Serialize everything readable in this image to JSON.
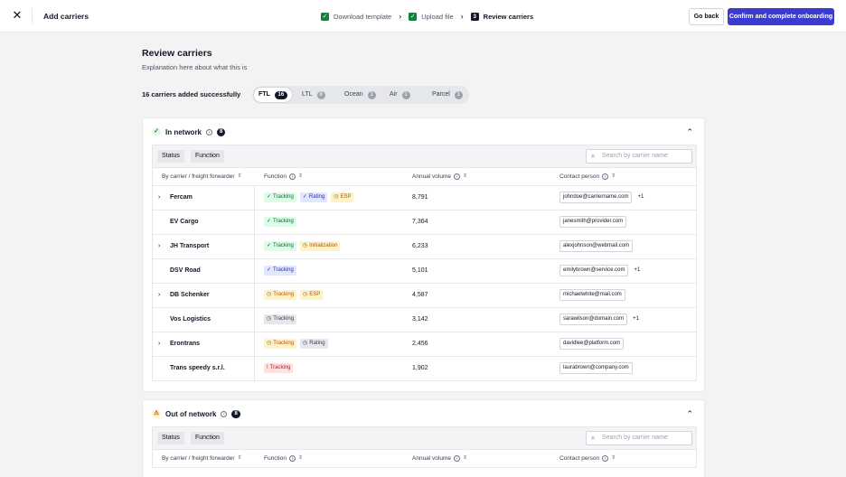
{
  "header": {
    "close_icon": "close-icon",
    "title": "Add carriers",
    "steps": [
      {
        "label": "Download template",
        "state": "done"
      },
      {
        "label": "Upload file",
        "state": "done"
      },
      {
        "label": "Review carriers",
        "number": "3",
        "state": "current"
      }
    ],
    "go_back": "Go back",
    "confirm": "Confirm and complete onboarding"
  },
  "page": {
    "title": "Review carriers",
    "subtitle": "Explanation here about what this is",
    "added_text": "16 carriers added successfully"
  },
  "modes": [
    {
      "label": "FTL",
      "count": "16",
      "active": true
    },
    {
      "label": "LTL",
      "count": "8"
    },
    {
      "label": "Ocean",
      "count": "1"
    },
    {
      "label": "Air",
      "count": "1"
    },
    {
      "label": "Parcel",
      "count": "1"
    }
  ],
  "in_network": {
    "title": "In network",
    "count": "8",
    "filters": [
      "Status",
      "Function"
    ],
    "search_placeholder": "Search by carrier name",
    "columns": [
      "By carrier / freight forwarder",
      "Function",
      "Annual volume",
      "Contact person"
    ],
    "rows": [
      {
        "expand": true,
        "name": "Fercam",
        "tags": [
          {
            "t": "Tracking",
            "c": "green",
            "i": "ok"
          },
          {
            "t": "Rating",
            "c": "blue",
            "i": "ok"
          },
          {
            "t": "ESP",
            "c": "amber",
            "i": "pending"
          }
        ],
        "volume": "8,791",
        "email": "johndoe@carriername.com",
        "more": "+1"
      },
      {
        "expand": false,
        "name": "EV Cargo",
        "tags": [
          {
            "t": "Tracking",
            "c": "green",
            "i": "ok"
          }
        ],
        "volume": "7,364",
        "email": "janesmith@provider.com",
        "more": ""
      },
      {
        "expand": true,
        "name": "JH Transport",
        "tags": [
          {
            "t": "Tracking",
            "c": "green",
            "i": "ok"
          },
          {
            "t": "Initialization",
            "c": "amber",
            "i": "pending"
          }
        ],
        "volume": "6,233",
        "email": "alexjohnson@webmail.com",
        "more": ""
      },
      {
        "expand": false,
        "name": "DSV Road",
        "tags": [
          {
            "t": "Tracking",
            "c": "blue",
            "i": "ok"
          }
        ],
        "volume": "5,101",
        "email": "emilybrown@service.com",
        "more": "+1"
      },
      {
        "expand": true,
        "name": "DB Schenker",
        "tags": [
          {
            "t": "Tracking",
            "c": "amber",
            "i": "pending"
          },
          {
            "t": "ESP",
            "c": "amber",
            "i": "pending"
          }
        ],
        "volume": "4,587",
        "email": "michaelwhite@mail.com",
        "more": ""
      },
      {
        "expand": false,
        "name": "Vos Logistics",
        "tags": [
          {
            "t": "Tracking",
            "c": "gray",
            "i": "pending"
          }
        ],
        "volume": "3,142",
        "email": "sarawilson@domain.com",
        "more": "+1"
      },
      {
        "expand": true,
        "name": "Erontrans",
        "tags": [
          {
            "t": "Tracking",
            "c": "amber",
            "i": "pending"
          },
          {
            "t": "Rating",
            "c": "gray",
            "i": "pending"
          }
        ],
        "volume": "2,456",
        "email": "davidlee@platform.com",
        "more": ""
      },
      {
        "expand": false,
        "name": "Trans speedy s.r.l.",
        "tags": [
          {
            "t": "Tracking",
            "c": "red",
            "i": "error"
          }
        ],
        "volume": "1,902",
        "email": "laurabrown@company.com",
        "more": ""
      }
    ]
  },
  "out_network": {
    "title": "Out of network",
    "count": "8",
    "filters": [
      "Status",
      "Function"
    ],
    "search_placeholder": "Search by carrier name",
    "columns": [
      "By carrier / freight forwarder",
      "Function",
      "Annual volume",
      "Contact person"
    ]
  },
  "colors": {
    "accent": "#3b3bd0",
    "success": "#15803d"
  }
}
